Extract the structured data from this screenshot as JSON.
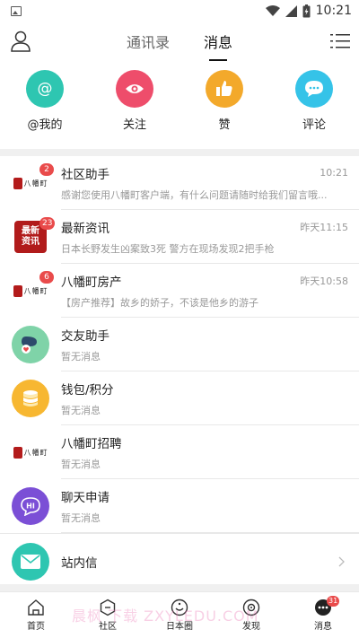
{
  "status_bar": {
    "time": "10:21"
  },
  "header": {
    "tabs": [
      {
        "label": "通讯录",
        "active": false
      },
      {
        "label": "消息",
        "active": true
      }
    ]
  },
  "quick_actions": [
    {
      "label": "@我的",
      "icon": "at-icon",
      "color": "#2ec6b1"
    },
    {
      "label": "关注",
      "icon": "eye-icon",
      "color": "#ee4d6b"
    },
    {
      "label": "赞",
      "icon": "thumbs-up-icon",
      "color": "#f3a92b"
    },
    {
      "label": "评论",
      "icon": "comment-icon",
      "color": "#35c3e8"
    }
  ],
  "messages": [
    {
      "title": "社区助手",
      "time": "10:21",
      "preview": "感谢您使用八幡町客户端，有什么问题请随时给我们留言哦...",
      "badge": "2"
    },
    {
      "title": "最新资讯",
      "time": "昨天11:15",
      "preview": "日本长野发生凶案致3死 警方在现场发现2把手枪",
      "badge": "23"
    },
    {
      "title": "八幡町房产",
      "time": "昨天10:58",
      "preview": "【房产推荐】故乡的娇子，不该是他乡的游子",
      "badge": "6"
    },
    {
      "title": "交友助手",
      "time": "",
      "preview": "暂无消息"
    },
    {
      "title": "钱包/积分",
      "time": "",
      "preview": "暂无消息"
    },
    {
      "title": "八幡町招聘",
      "time": "",
      "preview": "暂无消息"
    },
    {
      "title": "聊天申请",
      "time": "",
      "preview": "暂无消息"
    }
  ],
  "inbox": {
    "title": "站内信"
  },
  "logos": {
    "brand": "八幡町",
    "news_line1": "最新",
    "news_line2": "资讯"
  },
  "bottom_nav": [
    {
      "label": "首页",
      "icon": "home-icon"
    },
    {
      "label": "社区",
      "icon": "community-icon"
    },
    {
      "label": "日本圈",
      "icon": "circle-icon"
    },
    {
      "label": "发现",
      "icon": "discover-icon"
    },
    {
      "label": "消息",
      "icon": "message-icon",
      "badge": "31"
    }
  ],
  "watermark": "晨枫 下载 ZXYLEDU.COM"
}
